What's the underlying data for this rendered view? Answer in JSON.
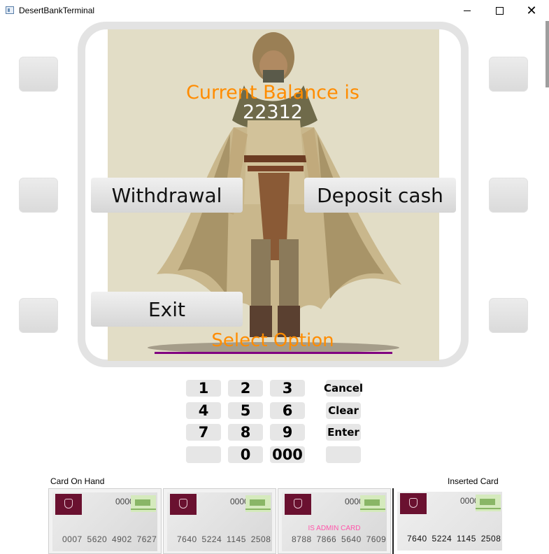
{
  "window": {
    "title": "DesertBankTerminal",
    "minimize": "—",
    "maximize": "☐",
    "close": "✕"
  },
  "screen": {
    "balance_label": "Current Balance is",
    "balance_value": "22312",
    "withdrawal_label": "Withdrawal",
    "deposit_label": "Deposit cash",
    "exit_label": "Exit",
    "select_option": "Select Option"
  },
  "keypad": {
    "k1": "1",
    "k2": "2",
    "k3": "3",
    "k4": "4",
    "k5": "5",
    "k6": "6",
    "k7": "7",
    "k8": "8",
    "k9": "9",
    "k0": "0",
    "k000": "000",
    "cancel": "Cancel",
    "clear": "Clear",
    "enter": "Enter"
  },
  "cards": {
    "on_hand_label": "Card On Hand",
    "inserted_label": "Inserted Card",
    "items": [
      {
        "code": "0000",
        "number": "0007 5620 4902 7627",
        "admin": ""
      },
      {
        "code": "0000",
        "number": "7640 5224 1145 2508",
        "admin": ""
      },
      {
        "code": "0000",
        "number": "8788 7866 5640 7609",
        "admin": "IS ADMIN CARD"
      }
    ],
    "inserted": {
      "code": "0000",
      "number": "7640 5224 1145 2508"
    }
  },
  "colors": {
    "accent": "#ff8c00",
    "underline": "#800080",
    "card_brand": "#6a1130"
  }
}
